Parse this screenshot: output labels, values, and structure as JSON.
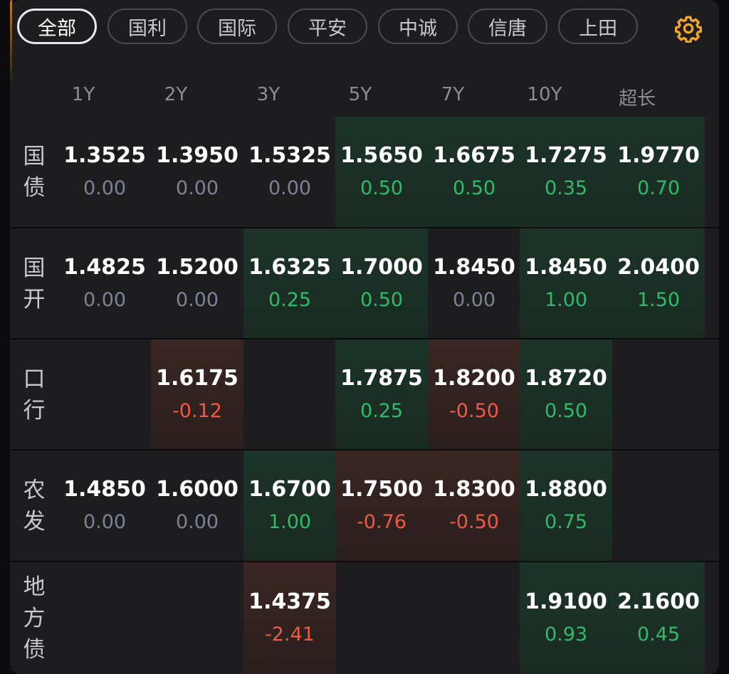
{
  "filters": {
    "chips": [
      "全部",
      "国利",
      "国际",
      "平安",
      "中诚",
      "信唐",
      "上田"
    ],
    "active": "全部",
    "settings_icon": "gear-icon",
    "accent": "#f5a623"
  },
  "table": {
    "tenors": [
      "1Y",
      "2Y",
      "3Y",
      "5Y",
      "7Y",
      "10Y",
      "超长"
    ],
    "rows": [
      {
        "label": [
          "国",
          "债"
        ],
        "cells": [
          {
            "price": "1.3525",
            "change": "0.00",
            "tone": "zero"
          },
          {
            "price": "1.3950",
            "change": "0.00",
            "tone": "zero"
          },
          {
            "price": "1.5325",
            "change": "0.00",
            "tone": "zero"
          },
          {
            "price": "1.5650",
            "change": "0.50",
            "tone": "green"
          },
          {
            "price": "1.6675",
            "change": "0.50",
            "tone": "green"
          },
          {
            "price": "1.7275",
            "change": "0.35",
            "tone": "green"
          },
          {
            "price": "1.9770",
            "change": "0.70",
            "tone": "green"
          }
        ]
      },
      {
        "label": [
          "国",
          "开"
        ],
        "cells": [
          {
            "price": "1.4825",
            "change": "0.00",
            "tone": "zero"
          },
          {
            "price": "1.5200",
            "change": "0.00",
            "tone": "zero"
          },
          {
            "price": "1.6325",
            "change": "0.25",
            "tone": "green"
          },
          {
            "price": "1.7000",
            "change": "0.50",
            "tone": "green"
          },
          {
            "price": "1.8450",
            "change": "0.00",
            "tone": "zero"
          },
          {
            "price": "1.8450",
            "change": "1.00",
            "tone": "green"
          },
          {
            "price": "2.0400",
            "change": "1.50",
            "tone": "green"
          }
        ]
      },
      {
        "label": [
          "口",
          "行"
        ],
        "cells": [
          null,
          {
            "price": "1.6175",
            "change": "-0.12",
            "tone": "red"
          },
          null,
          {
            "price": "1.7875",
            "change": "0.25",
            "tone": "green"
          },
          {
            "price": "1.8200",
            "change": "-0.50",
            "tone": "red"
          },
          {
            "price": "1.8720",
            "change": "0.50",
            "tone": "green"
          },
          null
        ]
      },
      {
        "label": [
          "农",
          "发"
        ],
        "cells": [
          {
            "price": "1.4850",
            "change": "0.00",
            "tone": "zero"
          },
          {
            "price": "1.6000",
            "change": "0.00",
            "tone": "zero"
          },
          {
            "price": "1.6700",
            "change": "1.00",
            "tone": "green"
          },
          {
            "price": "1.7500",
            "change": "-0.76",
            "tone": "red"
          },
          {
            "price": "1.8300",
            "change": "-0.50",
            "tone": "red"
          },
          {
            "price": "1.8800",
            "change": "0.75",
            "tone": "green"
          },
          null
        ]
      },
      {
        "label": [
          "地",
          "方",
          "债"
        ],
        "cells": [
          null,
          null,
          {
            "price": "1.4375",
            "change": "-2.41",
            "tone": "red"
          },
          null,
          null,
          {
            "price": "1.9100",
            "change": "0.93",
            "tone": "green"
          },
          {
            "price": "2.1600",
            "change": "0.45",
            "tone": "green"
          }
        ]
      }
    ]
  }
}
